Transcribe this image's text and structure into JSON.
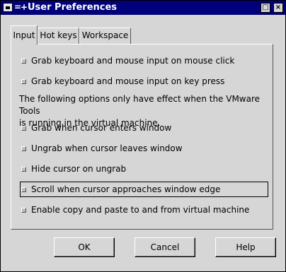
{
  "window": {
    "title": "User Preferences",
    "title_glyph": "=+",
    "buttons": {
      "restore": "□",
      "close": "×"
    }
  },
  "tabs": [
    {
      "label": "Input",
      "active": true
    },
    {
      "label": "Hot keys",
      "active": false
    },
    {
      "label": "Workspace",
      "active": false
    }
  ],
  "input_tab": {
    "options": [
      {
        "label": "Grab keyboard and mouse input on mouse click",
        "checked": false
      },
      {
        "label": "Grab keyboard and mouse input on key press",
        "checked": false
      },
      {
        "label": "Grab when cursor enters window",
        "checked": false
      },
      {
        "label": "Ungrab when cursor leaves window",
        "checked": false
      },
      {
        "label": "Hide cursor on ungrab",
        "checked": false
      },
      {
        "label": "Scroll when cursor approaches window edge",
        "checked": false
      },
      {
        "label": "Enable copy and paste to and from virtual machine",
        "checked": false
      }
    ],
    "note_line1": "The following options only have effect when the VMware Tools",
    "note_line2": "is running in the virtual machine."
  },
  "buttons": {
    "ok": "OK",
    "cancel": "Cancel",
    "help": "Help"
  },
  "colors": {
    "titlebar": "#00007b",
    "face": "#d6d6d6"
  }
}
